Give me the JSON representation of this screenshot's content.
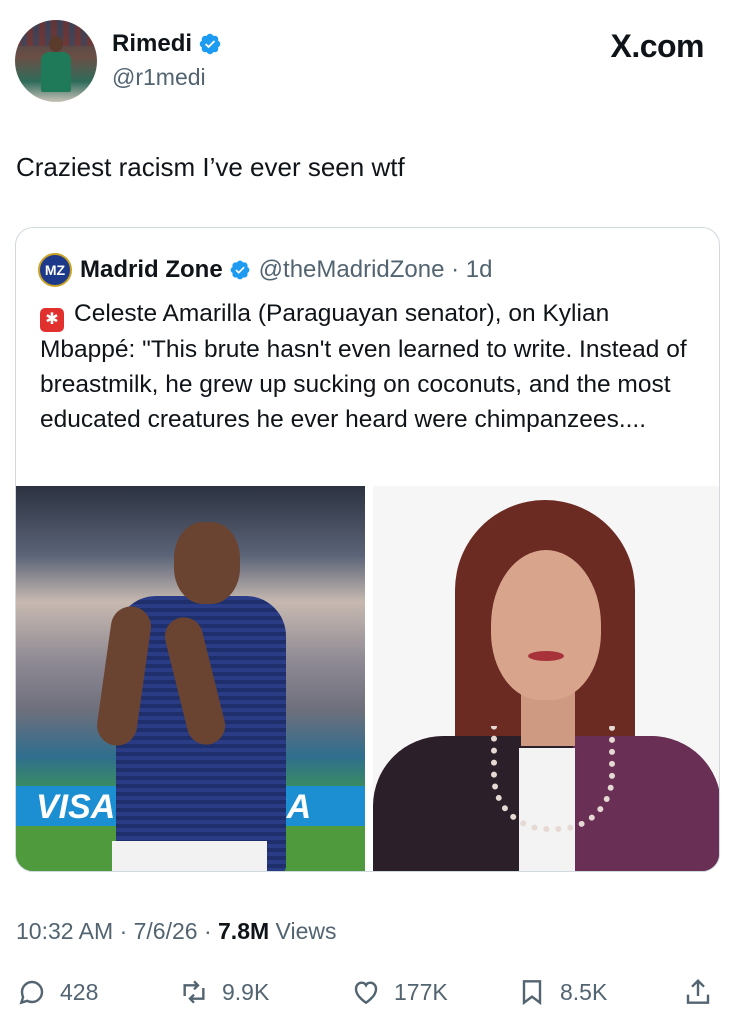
{
  "author": {
    "name": "Rimedi",
    "handle": "@r1medi"
  },
  "brand_text": "X.com",
  "tweet_text": "Craziest racism I’ve ever seen wtf",
  "quoted": {
    "logo_text": "MZ",
    "name": "Madrid Zone",
    "handle_time": "@theMadridZone · 1d",
    "body": "Celeste Amarilla (Paraguayan senator), on Kylian Mbappé: \"This brute hasn't even learned to write. Instead of breastmilk, he grew up sucking on coconuts, and the most educated creatures he ever heard were chimpanzees....",
    "images": [
      {
        "id": "mbappe",
        "banner_left": "VISA",
        "banner_right": "SA"
      },
      {
        "id": "senator"
      }
    ]
  },
  "meta": {
    "timestamp": "10:32 AM · 7/6/26 · ",
    "views_count": "7.8M",
    "views_label": " Views"
  },
  "actions": {
    "replies": "428",
    "reposts": "9.9K",
    "likes": "177K",
    "bookmarks": "8.5K"
  },
  "colors": {
    "verified": "#1d9bf0",
    "secondary_text": "#536471",
    "border": "#cfd9de"
  },
  "icons": [
    "verified-badge-icon",
    "siren-icon",
    "reply-icon",
    "repost-icon",
    "like-icon",
    "bookmark-icon",
    "share-icon"
  ]
}
